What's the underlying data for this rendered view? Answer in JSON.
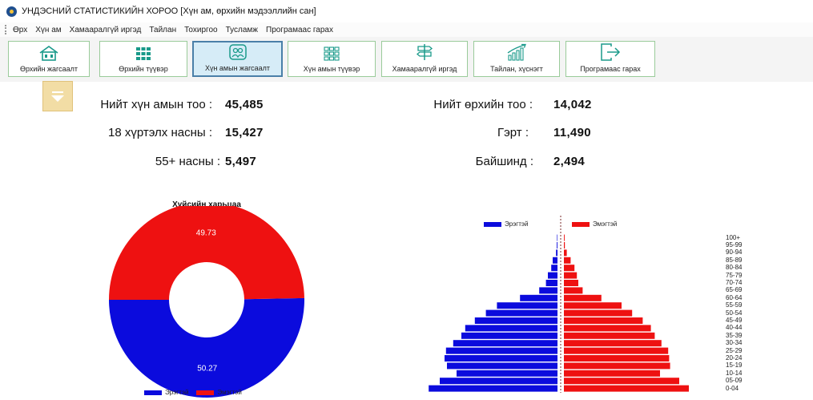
{
  "window": {
    "title": "УНДЭСНИЙ СТАТИСТИКИЙН ХОРОО [Хүн ам, өрхийн мэдээллийн сан]"
  },
  "menu": [
    "Өрх",
    "Хүн ам",
    "Хамааралгүй иргэд",
    "Тайлан",
    "Тохиргоо",
    "Тусламж",
    "Програмаас гарах"
  ],
  "toolbar": {
    "buttons": [
      {
        "label": "Өрхийн жагсаалт",
        "icon": "house-icon",
        "active": false
      },
      {
        "label": "Өрхийн түүвэр",
        "icon": "grid-icon",
        "active": false
      },
      {
        "label": "Хүн амын жагсаалт",
        "icon": "people-icon",
        "active": true
      },
      {
        "label": "Хүн амын түүвэр",
        "icon": "grid-outline-icon",
        "active": false
      },
      {
        "label": "Хамааралгүй иргэд",
        "icon": "signpost-icon",
        "active": false
      },
      {
        "label": "Тайлан, хүснэгт",
        "icon": "chart-icon",
        "active": false
      },
      {
        "label": "Програмаас гарах",
        "icon": "exit-icon",
        "active": false
      }
    ]
  },
  "stats": {
    "total_population_label": "Нийт хүн амын тоо :",
    "total_population": "45,485",
    "under18_label": "18 хүртэлх насны :",
    "under18": "15,427",
    "over55_label": "55+ насны :",
    "over55": "5,497",
    "total_households_label": "Нийт өрхийн тоо :",
    "total_households": "14,042",
    "ger_label": "Гэрт :",
    "ger": "11,490",
    "building_label": "Байшинд :",
    "building": "2,494"
  },
  "colors": {
    "male": "#0b0bdd",
    "female": "#ee1111",
    "toolbar_active": "#d6ecf7"
  },
  "chart_data": [
    {
      "type": "pie",
      "title": "Хүйсийн харьцаа",
      "donut": true,
      "slices": [
        {
          "name": "Эрэгтэй",
          "value": 50.27,
          "label": "50.27"
        },
        {
          "name": "Эмэгтэй",
          "value": 49.73,
          "label": "49.73"
        }
      ],
      "legend": [
        "Эрэгтэй",
        "Эмэгтэй"
      ],
      "legend_position": "bottom"
    },
    {
      "type": "bar",
      "orientation": "horizontal",
      "subtype": "population-pyramid",
      "categories": [
        "0-04",
        "05-09",
        "10-14",
        "15-19",
        "20-24",
        "25-29",
        "30-34",
        "35-39",
        "40-44",
        "45-49",
        "50-54",
        "55-59",
        "60-64",
        "65-69",
        "70-74",
        "75-79",
        "80-84",
        "85-89",
        "90-94",
        "95-99",
        "100+"
      ],
      "series": [
        {
          "name": "Эрэгтэй",
          "values": [
            2680,
            2450,
            2100,
            2300,
            2350,
            2320,
            2170,
            2000,
            1920,
            1720,
            1490,
            1260,
            780,
            380,
            240,
            200,
            130,
            100,
            30,
            15,
            10
          ]
        },
        {
          "name": "Эмэгтэй",
          "values": [
            2600,
            2400,
            2000,
            2210,
            2190,
            2170,
            2030,
            1890,
            1810,
            1640,
            1420,
            1200,
            780,
            390,
            300,
            270,
            220,
            140,
            60,
            20,
            15
          ]
        }
      ],
      "legend": [
        "Эрэгтэй",
        "Эмэгтэй"
      ],
      "legend_position": "top"
    }
  ]
}
